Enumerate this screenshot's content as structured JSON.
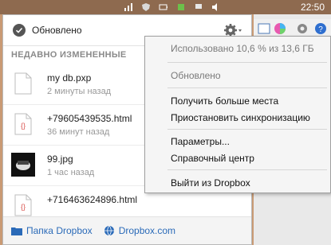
{
  "taskbar": {
    "clock": "22:50"
  },
  "panel": {
    "status": "Обновлено",
    "section_title": "НЕДАВНО ИЗМЕНЕННЫЕ",
    "files": [
      {
        "name": "my db.pxp",
        "time": "2 минуты назад",
        "icon": "document-icon"
      },
      {
        "name": "+79605439535.html",
        "time": "36 минут назад",
        "icon": "html-file-icon"
      },
      {
        "name": "99.jpg",
        "time": "1 час назад",
        "icon": "image-thumbnail"
      },
      {
        "name": "+716463624896.html",
        "time": "",
        "icon": "html-file-icon"
      }
    ],
    "footer": {
      "folder_label": "Папка Dropbox",
      "site_label": "Dropbox.com"
    }
  },
  "menu": {
    "usage": "Использовано 10,6 % из 13,6 ГБ",
    "status": "Обновлено",
    "items": [
      "Получить больше места",
      "Приостановить синхронизацию",
      "Параметры...",
      "Справочный центр",
      "Выйти из Dropbox"
    ]
  },
  "colors": {
    "accent": "#2a6ab8",
    "background": "#c99a74"
  }
}
